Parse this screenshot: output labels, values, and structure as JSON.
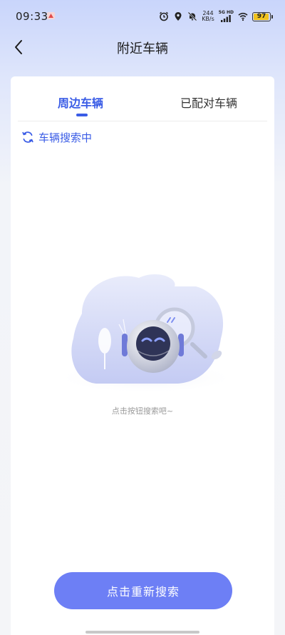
{
  "status_bar": {
    "time": "09:33",
    "net_speed_value": "244",
    "net_speed_unit": "KB/s",
    "signal_label": "5G HD",
    "battery": "97",
    "battery_level": 0.97,
    "icons": [
      "app-notification-icon",
      "alarm-icon",
      "location-icon",
      "mute-icon",
      "signal-icon",
      "wifi-icon",
      "battery-icon"
    ]
  },
  "header": {
    "title": "附近车辆",
    "back_icon": "chevron-left-icon"
  },
  "tabs": [
    {
      "label": "周边车辆",
      "active": true
    },
    {
      "label": "已配对车辆",
      "active": false
    }
  ],
  "search_status": {
    "icon": "refresh-icon",
    "text": "车辆搜索中"
  },
  "empty_state": {
    "hint": "点击按钮搜索吧~"
  },
  "actions": {
    "retry_label": "点击重新搜索"
  },
  "colors": {
    "accent": "#3a5ce6",
    "button": "#6d7ff5",
    "battery": "#f0c21e"
  }
}
